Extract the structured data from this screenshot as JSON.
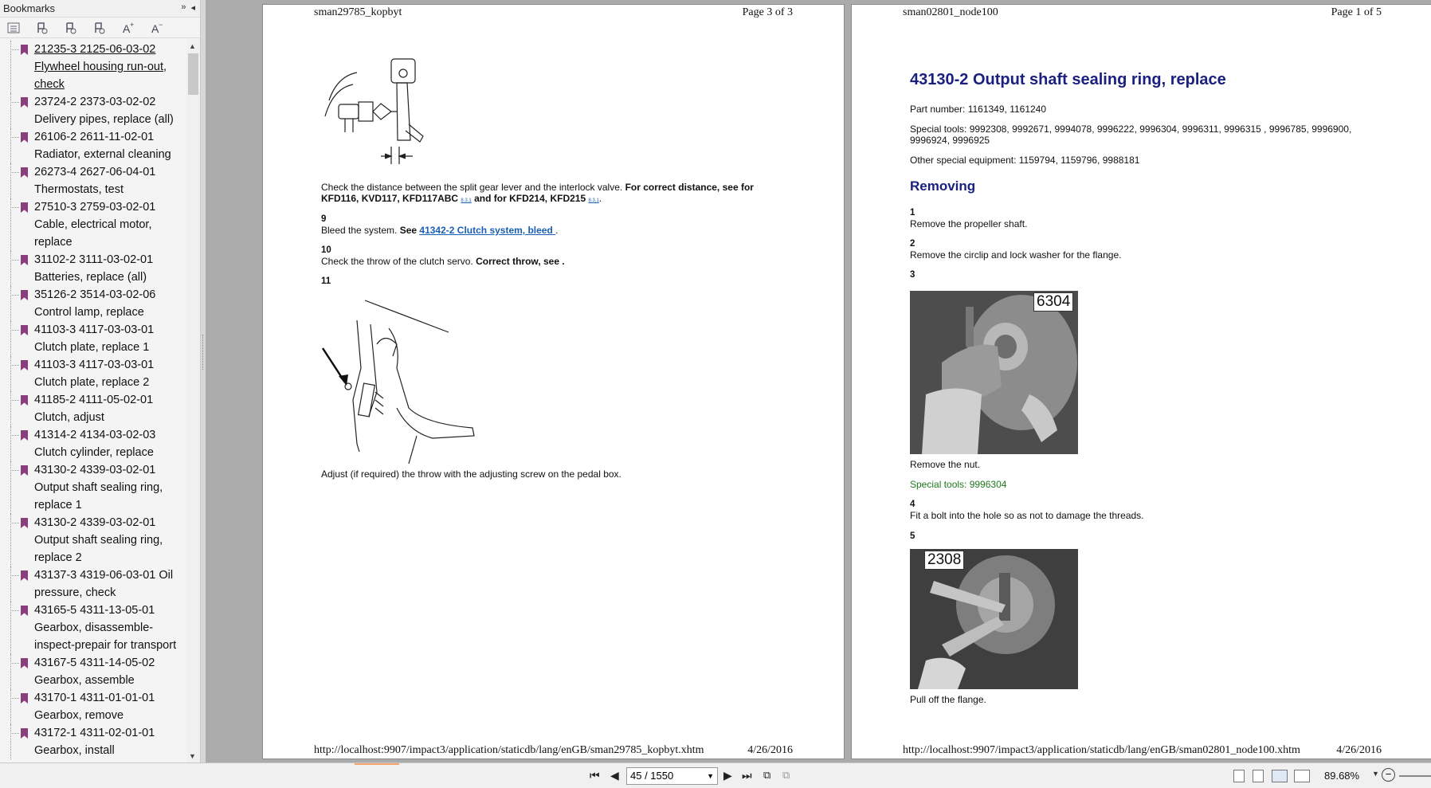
{
  "sidebar": {
    "title": "Bookmarks",
    "header_buttons": [
      "»",
      "◂"
    ],
    "toolbar_icons": [
      "list-options-icon",
      "bookmark-expand-icon",
      "bookmark-collapse-icon",
      "bookmark-new-icon",
      "text-larger-icon",
      "text-smaller-icon"
    ],
    "items": [
      "21235-3 2125-06-03-02 Flywheel housing run-out, check",
      "23724-2 2373-03-02-02 Delivery pipes, replace (all)",
      "26106-2 2611-11-02-01 Radiator, external cleaning",
      "26273-4 2627-06-04-01 Thermostats, test",
      "27510-3 2759-03-02-01 Cable, electrical motor, replace",
      "31102-2 3111-03-02-01 Batteries, replace (all)",
      "35126-2 3514-03-02-06 Control lamp, replace",
      "41103-3 4117-03-03-01 Clutch plate, replace  1",
      "41103-3 4117-03-03-01 Clutch plate, replace 2",
      "41185-2 4111-05-02-01 Clutch, adjust",
      "41314-2 4134-03-02-03 Clutch cylinder, replace",
      "43130-2 4339-03-02-01 Output shaft sealing ring, replace 1",
      "43130-2 4339-03-02-01 Output shaft sealing ring, replace 2",
      "43137-3 4319-06-03-01 Oil pressure, check",
      "43165-5 4311-13-05-01 Gearbox, disassemble-inspect-prepair for transport",
      "43167-5 4311-14-05-02 Gearbox, assemble",
      "43170-1 4311-01-01-01 Gearbox, remove",
      "43172-1 4311-02-01-01 Gearbox, install"
    ]
  },
  "left_page": {
    "header_left": "sman29785_kopbyt",
    "header_right": "Page 3 of 3",
    "check_text_normal": "Check the distance between the split gear lever and the interlock valve. ",
    "check_text_bold_1": "For correct distance, see for KFD116, KVD117, KFD117ABC ",
    "check_text_bold_2": " and for KFD214, KFD215 ",
    "tiny_link": "8.3.1",
    "step9_num": "9",
    "step9_text": "Bleed the system. ",
    "step9_see": "See ",
    "step9_link": "41342-2 Clutch system, bleed ",
    "step10_num": "10",
    "step10_text": "Check the throw of the clutch servo. ",
    "step10_bold": "Correct throw, see  .",
    "step11_num": "11",
    "adjust_text": "Adjust (if required) the throw with the adjusting screw on the pedal box.",
    "footer_url": "http://localhost:9907/impact3/application/staticdb/lang/enGB/sman29785_kopbyt.xhtm",
    "footer_date": "4/26/2016"
  },
  "right_page": {
    "header_left": "sman02801_node100",
    "header_right": "Page 1 of 5",
    "title": "43130-2 Output shaft sealing ring, replace",
    "part_number": "Part number: 1161349, 1161240",
    "special_tools": "Special tools: 9992308, 9992671, 9994078, 9996222, 9996304, 9996311, 9996315 , 9996785, 9996900, 9996924, 9996925",
    "other_equipment": "Other special equipment: 1159794, 1159796, 9988181",
    "section": "Removing",
    "step1_num": "1",
    "step1_text": "Remove the propeller shaft.",
    "step2_num": "2",
    "step2_text": "Remove the circlip and lock washer for the flange.",
    "step3_num": "3",
    "photo1_label": "6304",
    "step3_text": "Remove the nut.",
    "step3_tools": "Special tools: 9996304",
    "step4_num": "4",
    "step4_text": "Fit a bolt into the hole so as not to damage the threads.",
    "step5_num": "5",
    "photo2_label": "2308",
    "step5_text": "Pull off the flange.",
    "footer_url": "http://localhost:9907/impact3/application/staticdb/lang/enGB/sman02801_node100.xhtm",
    "footer_date": "4/26/2016"
  },
  "bottombar": {
    "page_value": "45 / 1550",
    "zoom": "89.68%",
    "accent": "#f5a36a"
  }
}
